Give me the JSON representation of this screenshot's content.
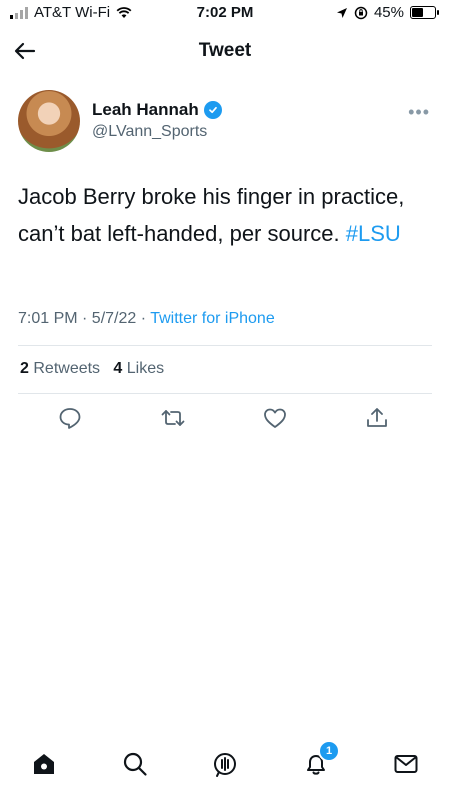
{
  "status_bar": {
    "carrier": "AT&T Wi-Fi",
    "time": "7:02 PM",
    "battery": "45%"
  },
  "header": {
    "title": "Tweet"
  },
  "tweet": {
    "author_name": "Leah Hannah",
    "handle": "@LVann_Sports",
    "text_before": "Jacob Berry broke his finger in practice, can’t bat left-handed, per source. ",
    "hashtag": "#LSU",
    "timestamp": "7:01 PM · 5/7/22 · ",
    "client": "Twitter for iPhone",
    "retweets_count": "2",
    "retweets_label": "Retweets",
    "likes_count": "4",
    "likes_label": "Likes"
  },
  "actions": [
    "reply-icon",
    "retweet-icon",
    "like-icon",
    "share-icon"
  ],
  "tabbar": {
    "items": [
      "home-icon",
      "search-icon",
      "spaces-icon",
      "notifications-icon",
      "messages-icon"
    ],
    "notification_badge": "1"
  },
  "colors": {
    "accent": "#1d9bf0",
    "secondary_text": "#536471"
  }
}
